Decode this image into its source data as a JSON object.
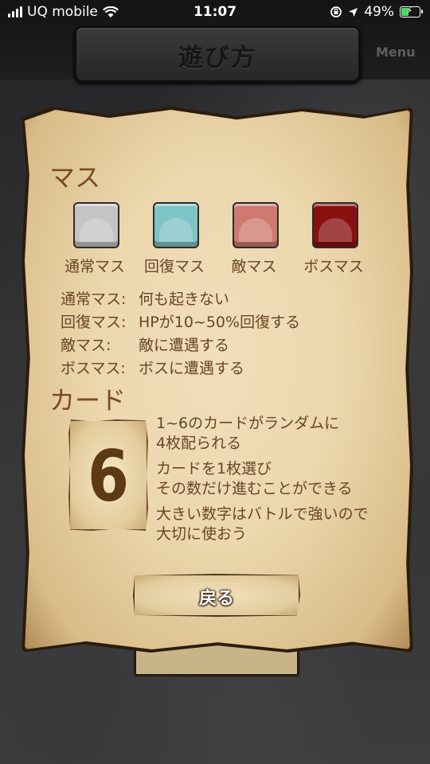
{
  "status_bar": {
    "carrier": "UQ mobile",
    "time": "11:07",
    "battery": "49%",
    "battery_level": 0.49
  },
  "header": {
    "title": "遊び方",
    "menu_label": "Menu"
  },
  "squares_section": {
    "heading": "マス",
    "tiles": [
      {
        "label": "通常マス",
        "color": "#c4c4c4"
      },
      {
        "label": "回復マス",
        "color": "#7ec3c6"
      },
      {
        "label": "敵マス",
        "color": "#cf7a70"
      },
      {
        "label": "ボスマス",
        "color": "#8a1010"
      }
    ],
    "descriptions": [
      {
        "label": "通常マス:",
        "text": "何も起きない"
      },
      {
        "label": "回復マス:",
        "text": "HPが10~50%回復する"
      },
      {
        "label": "敵マス:",
        "text": "敵に遭遇する"
      },
      {
        "label": "ボスマス:",
        "text": "ボスに遭遇する"
      }
    ]
  },
  "cards_section": {
    "heading": "カード",
    "card_value": "6",
    "lines": [
      "1~6のカードがランダムに",
      "4枚配られる",
      "カードを1枚選び",
      "その数だけ進むことができる",
      "大きい数字はバトルで強いので",
      "大切に使おう"
    ]
  },
  "back_button": {
    "label": "戻る"
  },
  "colors": {
    "parchment": "#ecd7ae",
    "text_brown": "#6a4528",
    "heading_brown": "#7a4a26",
    "card_number": "#5c3a14"
  }
}
